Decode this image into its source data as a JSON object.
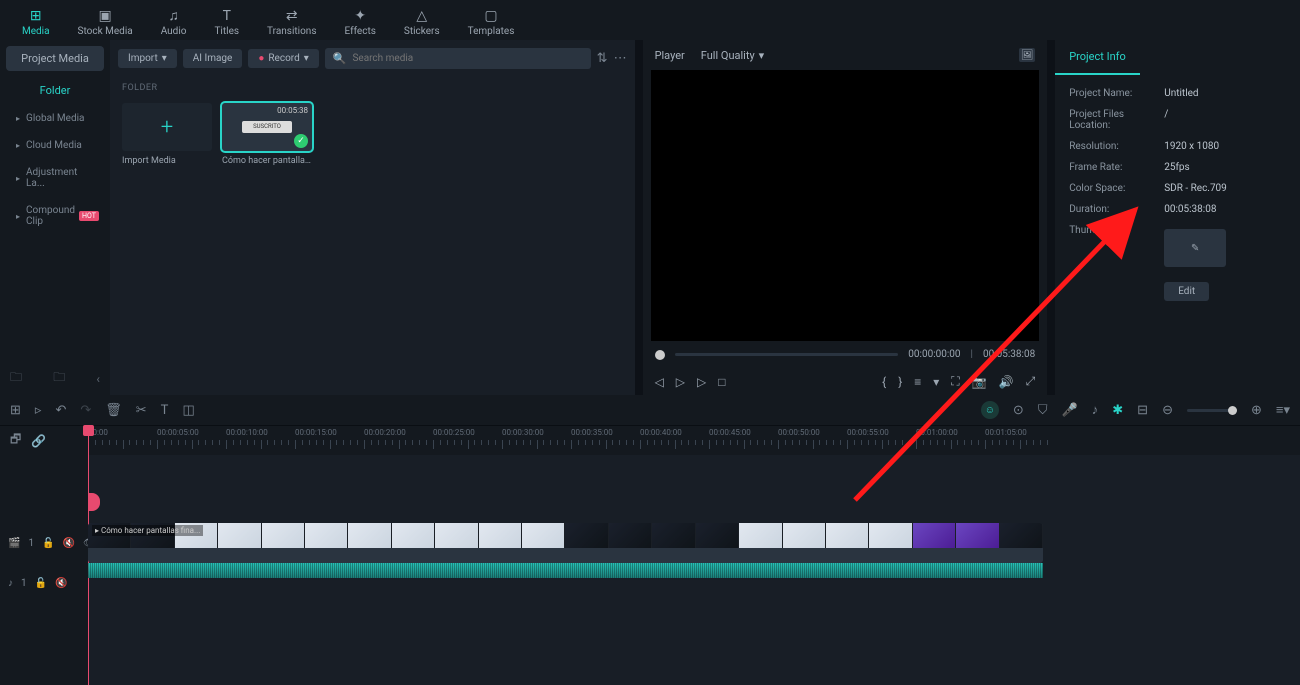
{
  "top_tabs": [
    {
      "label": "Media",
      "icon": "⊞"
    },
    {
      "label": "Stock Media",
      "icon": "▣"
    },
    {
      "label": "Audio",
      "icon": "♫"
    },
    {
      "label": "Titles",
      "icon": "T"
    },
    {
      "label": "Transitions",
      "icon": "⇄"
    },
    {
      "label": "Effects",
      "icon": "✦"
    },
    {
      "label": "Stickers",
      "icon": "△"
    },
    {
      "label": "Templates",
      "icon": "▢"
    }
  ],
  "sidebar": {
    "project_media": "Project Media",
    "folder": "Folder",
    "items": [
      "Global Media",
      "Cloud Media",
      "Adjustment La...",
      "Compound Clip"
    ]
  },
  "mid": {
    "import": "Import",
    "ai_image": "AI Image",
    "record": "Record",
    "search_placeholder": "Search media",
    "folder_hdr": "FOLDER",
    "import_media": "Import Media",
    "clip_name": "Cómo hacer pantallas ...",
    "clip_dur": "00:05:38"
  },
  "player": {
    "label": "Player",
    "quality": "Full Quality",
    "cur": "00:00:00:00",
    "total": "00:05:38:08"
  },
  "info": {
    "tab": "Project Info",
    "rows": [
      {
        "k": "Project Name:",
        "v": "Untitled"
      },
      {
        "k": "Project Files Location:",
        "v": "/"
      },
      {
        "k": "Resolution:",
        "v": "1920 x 1080"
      },
      {
        "k": "Frame Rate:",
        "v": "25fps"
      },
      {
        "k": "Color Space:",
        "v": "SDR - Rec.709"
      },
      {
        "k": "Duration:",
        "v": "00:05:38:08"
      }
    ],
    "thumbnail": "Thumbnail:",
    "edit": "Edit"
  },
  "timeline": {
    "ruler": [
      "00:00",
      "00:00:05:00",
      "00:00:10:00",
      "00:00:15:00",
      "00:00:20:00",
      "00:00:25:00",
      "00:00:30:00",
      "00:00:35:00",
      "00:00:40:00",
      "00:00:45:00",
      "00:00:50:00",
      "00:00:55:00",
      "00:01:00:00",
      "00:01:05:00"
    ],
    "clip_label": "Cómo hacer pantallas fina..."
  }
}
